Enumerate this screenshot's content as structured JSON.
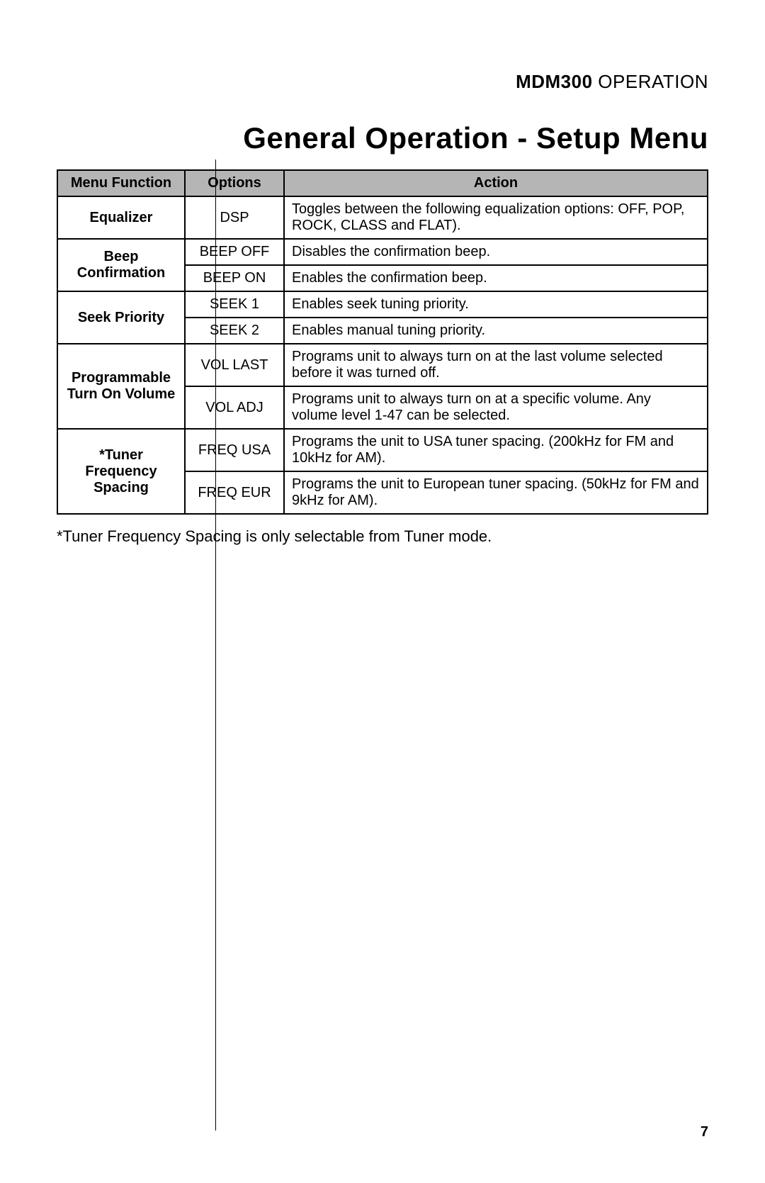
{
  "header": {
    "product": "MDM300",
    "section": "OPERATION"
  },
  "title": "General Operation - Setup Menu",
  "table": {
    "headers": {
      "menu_function": "Menu Function",
      "options": "Options",
      "action": "Action"
    },
    "groups": [
      {
        "menu_function": "Equalizer",
        "rows": [
          {
            "option": "DSP",
            "action": "Toggles between the following equalization options: OFF, POP, ROCK, CLASS and FLAT)."
          }
        ]
      },
      {
        "menu_function": "Beep Confirmation",
        "rows": [
          {
            "option": "BEEP OFF",
            "action": "Disables the confirmation beep."
          },
          {
            "option": "BEEP ON",
            "action": "Enables the confirmation beep."
          }
        ]
      },
      {
        "menu_function": "Seek Priority",
        "rows": [
          {
            "option": "SEEK 1",
            "action": "Enables seek tuning priority."
          },
          {
            "option": "SEEK 2",
            "action": "Enables manual tuning priority."
          }
        ]
      },
      {
        "menu_function": "Programmable Turn On Volume",
        "rows": [
          {
            "option": "VOL LAST",
            "action": "Programs unit to always turn on at the last volume selected before it was turned off."
          },
          {
            "option": "VOL ADJ",
            "action": "Programs unit to always turn on at a specific volume. Any volume level 1-47 can be selected."
          }
        ]
      },
      {
        "menu_function": "*Tuner Frequency Spacing",
        "rows": [
          {
            "option": "FREQ USA",
            "action": "Programs the unit to USA tuner spacing. (200kHz for FM and 10kHz for AM)."
          },
          {
            "option": "FREQ EUR",
            "action": "Programs the unit to European tuner spacing. (50kHz for FM and 9kHz for AM)."
          }
        ]
      }
    ]
  },
  "footnote": "*Tuner Frequency Spacing is only selectable from Tuner mode.",
  "page_number": "7"
}
